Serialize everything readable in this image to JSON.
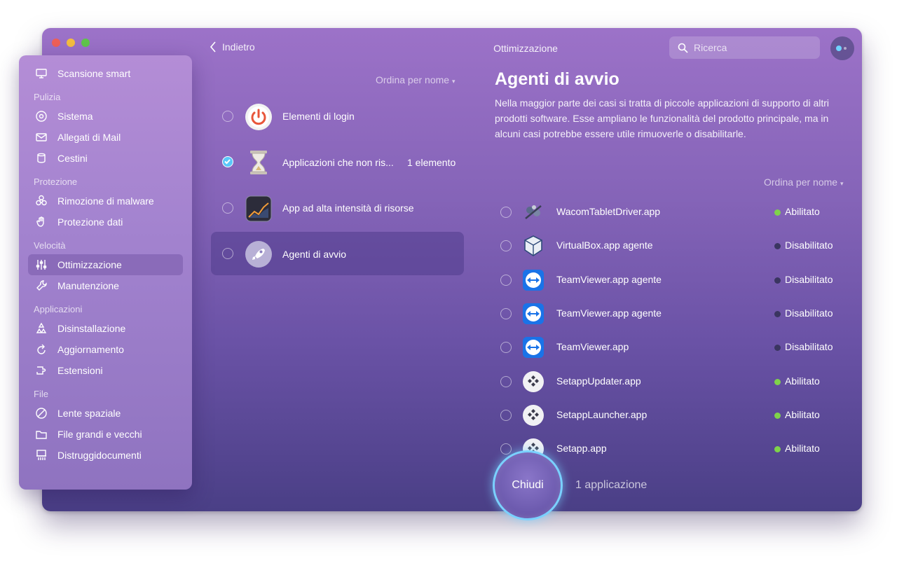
{
  "window": {
    "title": "Ottimizzazione"
  },
  "toolbar": {
    "back_label": "Indietro",
    "search_placeholder": "Ricerca"
  },
  "sidebar": {
    "items": [
      {
        "label": "Scansione smart",
        "icon": "monitor-icon"
      }
    ],
    "sections": [
      {
        "title": "Pulizia",
        "items": [
          {
            "label": "Sistema",
            "icon": "disk-icon"
          },
          {
            "label": "Allegati di Mail",
            "icon": "mail-icon"
          },
          {
            "label": "Cestini",
            "icon": "trash-icon"
          }
        ]
      },
      {
        "title": "Protezione",
        "items": [
          {
            "label": "Rimozione di malware",
            "icon": "biohazard-icon"
          },
          {
            "label": "Protezione dati",
            "icon": "hand-icon"
          }
        ]
      },
      {
        "title": "Velocità",
        "items": [
          {
            "label": "Ottimizzazione",
            "icon": "sliders-icon",
            "active": true
          },
          {
            "label": "Manutenzione",
            "icon": "wrench-icon"
          }
        ]
      },
      {
        "title": "Applicazioni",
        "items": [
          {
            "label": "Disinstallazione",
            "icon": "apps-icon"
          },
          {
            "label": "Aggiornamento",
            "icon": "update-icon"
          },
          {
            "label": "Estensioni",
            "icon": "extension-icon"
          }
        ]
      },
      {
        "title": "File",
        "items": [
          {
            "label": "Lente spaziale",
            "icon": "space-lens-icon"
          },
          {
            "label": "File grandi e vecchi",
            "icon": "folder-icon"
          },
          {
            "label": "Distruggidocumenti",
            "icon": "shredder-icon"
          }
        ]
      }
    ]
  },
  "categories": {
    "sort_label": "Ordina per nome",
    "items": [
      {
        "label": "Elementi di login",
        "count": "",
        "icon": "power-icon",
        "checked": false,
        "active": false
      },
      {
        "label": "Applicazioni che non ris...",
        "count": "1 elemento",
        "icon": "hourglass-icon",
        "checked": true,
        "active": false
      },
      {
        "label": "App ad alta intensità di risorse",
        "count": "",
        "icon": "activity-chart-icon",
        "checked": false,
        "active": false
      },
      {
        "label": "Agenti di avvio",
        "count": "",
        "icon": "rocket-icon",
        "checked": false,
        "active": true
      }
    ]
  },
  "detail": {
    "title": "Agenti di avvio",
    "description": "Nella maggior parte dei casi si tratta di piccole applicazioni di supporto di altri prodotti software. Esse ampliano le funzionalità del prodotto principale, ma in alcuni casi potrebbe essere utile rimuoverle o disabilitarle.",
    "sort_label": "Ordina per nome",
    "agents": [
      {
        "name": "WacomTabletDriver.app",
        "status": "Abilitato",
        "enabled": true,
        "icon": "wacom-icon"
      },
      {
        "name": "VirtualBox.app agente",
        "status": "Disabilitato",
        "enabled": false,
        "icon": "virtualbox-icon"
      },
      {
        "name": "TeamViewer.app agente",
        "status": "Disabilitato",
        "enabled": false,
        "icon": "teamviewer-icon"
      },
      {
        "name": "TeamViewer.app agente",
        "status": "Disabilitato",
        "enabled": false,
        "icon": "teamviewer-icon"
      },
      {
        "name": "TeamViewer.app",
        "status": "Disabilitato",
        "enabled": false,
        "icon": "teamviewer-icon"
      },
      {
        "name": "SetappUpdater.app",
        "status": "Abilitato",
        "enabled": true,
        "icon": "setapp-icon"
      },
      {
        "name": "SetappLauncher.app",
        "status": "Abilitato",
        "enabled": true,
        "icon": "setapp-icon"
      },
      {
        "name": "Setapp.app",
        "status": "Abilitato",
        "enabled": true,
        "icon": "setapp-icon"
      }
    ]
  },
  "footer": {
    "close_label": "Chiudi",
    "selection_summary": "1 applicazione"
  },
  "colors": {
    "accent": "#5ac8fa",
    "enabled": "#7fd34a",
    "disabled": "#3a3560"
  }
}
